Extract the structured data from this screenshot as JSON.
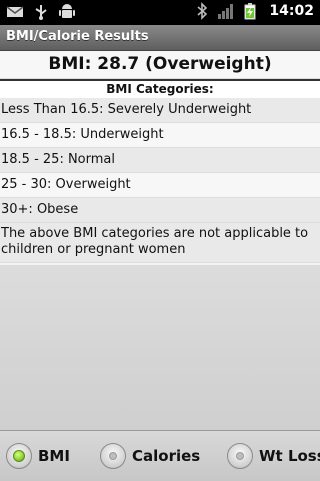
{
  "status_bar": {
    "time": "14:02",
    "icons": [
      "mail-icon",
      "usb-icon",
      "android-debug-icon",
      "bluetooth-icon",
      "signal-icon",
      "battery-charging-icon"
    ]
  },
  "title_bar": {
    "title": "BMI/Calorie Results"
  },
  "result": {
    "text": "BMI: 28.7 (Overweight)"
  },
  "categories": {
    "header": "BMI Categories:",
    "items": [
      "Less Than 16.5: Severely Underweight",
      "16.5 - 18.5: Underweight",
      "18.5 - 25: Normal",
      "25 - 30: Overweight",
      "30+: Obese"
    ],
    "note": "The above BMI categories are not applicable to children or pregnant women"
  },
  "tabs": [
    {
      "label": "BMI",
      "selected": true
    },
    {
      "label": "Calories",
      "selected": false
    },
    {
      "label": "Wt Loss",
      "selected": false
    }
  ],
  "colors": {
    "selected_radio": "#8fd43a",
    "title_bar": "#7a7a7a"
  }
}
